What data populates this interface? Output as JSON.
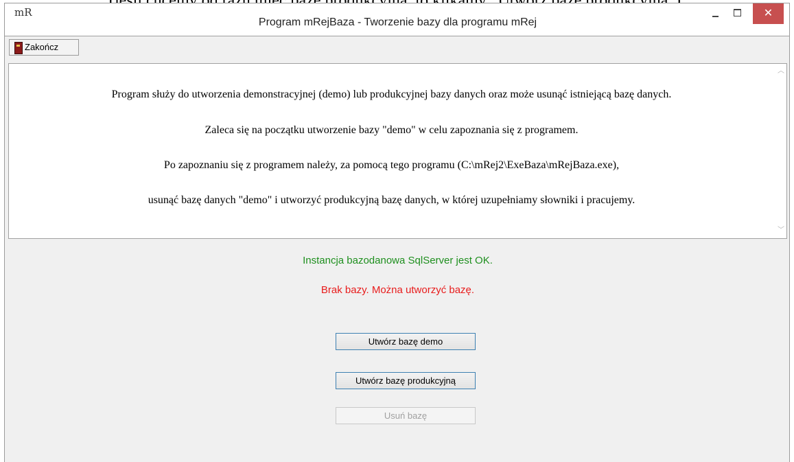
{
  "doc_fragment": "(jeśli chcemy od razu mieć bazę produkcyjną, to klikamy „Utwórz bazę produkcyjną”).",
  "window": {
    "title": "Program mRejBaza - Tworzenie bazy dla programu mRej",
    "icon_text": "mR",
    "controls": {
      "close_glyph": "✕"
    }
  },
  "toolbar": {
    "exit_label": "Zakończ"
  },
  "info": {
    "lines": [
      "Program służy do utworzenia demonstracyjnej (demo) lub produkcyjnej bazy danych oraz może usunąć istniejącą bazę danych.",
      "Zaleca się na początku utworzenie bazy \"demo\" w celu zapoznania się z programem.",
      "Po zapoznaniu się z programem należy, za pomocą tego programu (C:\\mRej2\\ExeBaza\\mRejBaza.exe),",
      "usunąć bazę danych \"demo\" i utworzyć produkcyjną bazę danych, w której uzupełniamy słowniki i pracujemy."
    ]
  },
  "status": {
    "instance": "Instancja bazodanowa SqlServer jest OK.",
    "database": "Brak bazy. Można utworzyć bazę."
  },
  "buttons": {
    "create_demo": "Utwórz bazę demo",
    "create_production": "Utwórz bazę produkcyjną",
    "delete": "Usuń bazę"
  },
  "colors": {
    "status_ok": "#1e8f1e",
    "status_error": "#e81c1c",
    "close_button": "#c74f4f"
  }
}
